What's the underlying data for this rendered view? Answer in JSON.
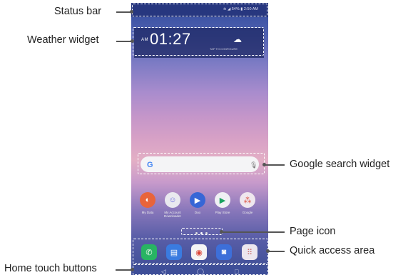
{
  "labels": {
    "status_bar": "Status bar",
    "weather_widget": "Weather widget",
    "google_search_widget": "Google search widget",
    "page_icon": "Page icon",
    "quick_access_area": "Quick access area",
    "home_touch_buttons": "Home touch buttons"
  },
  "phone": {
    "status_text": "≋ ◢ 54% ▮ 2:50 AM",
    "clock_ampm": "AM",
    "clock_time": "01:27",
    "weather_sub": "TAP TO CONFIGURE",
    "apps": [
      "My Data",
      "My Account Downloader",
      "Duo",
      "Play Store",
      "Google"
    ],
    "nav": [
      "◁",
      "◯",
      "□"
    ]
  },
  "colors": {
    "accent": "#27377f",
    "annotation": "#555555"
  }
}
